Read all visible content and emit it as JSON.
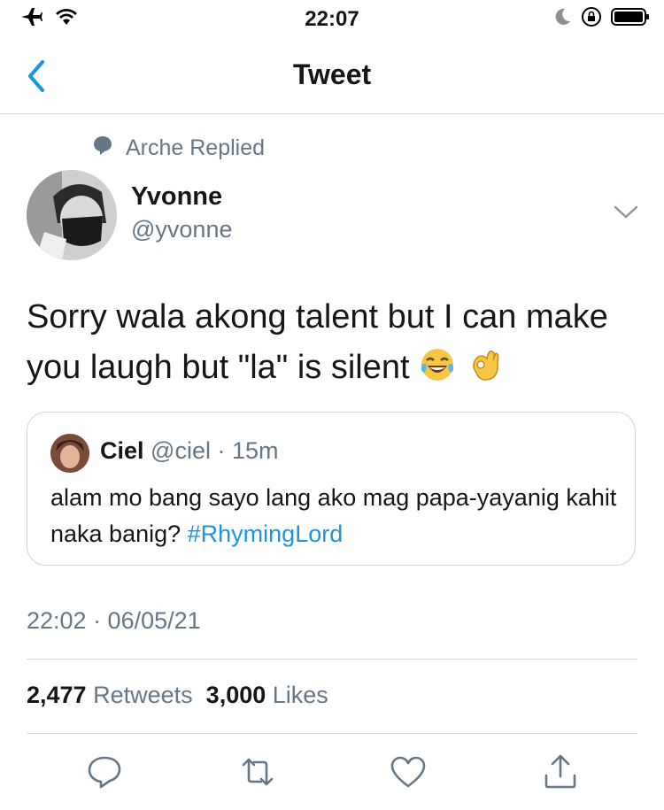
{
  "status_bar": {
    "time": "22:07"
  },
  "nav": {
    "title": "Tweet"
  },
  "social_context": {
    "text": "Arche Replied"
  },
  "tweet": {
    "author_name": "Yvonne",
    "author_handle": "@yvonne",
    "text": "Sorry wala akong talent but I can make you laugh but \"la\" is silent",
    "emojis": [
      "face-with-tears-of-joy-emoji",
      "ok-hand-emoji"
    ],
    "timestamp": "22:02 · 06/05/21"
  },
  "quoted_tweet": {
    "author_name": "Ciel",
    "author_handle": "@ciel",
    "separator": " · ",
    "age": "15m",
    "text": "alam mo bang sayo lang ako mag papa-yayanig kahit naka banig? ",
    "hashtag": "#RhymingLord"
  },
  "stats": {
    "retweets_count": "2,477",
    "retweets_label": "Retweets",
    "likes_count": "3,000",
    "likes_label": "Likes"
  },
  "actions": [
    "reply-icon",
    "retweet-icon",
    "like-icon",
    "share-icon"
  ],
  "colors": {
    "link": "#1b95e0",
    "secondary_text": "#657786",
    "primary_text": "#14171a",
    "divider": "#d8dde1"
  }
}
